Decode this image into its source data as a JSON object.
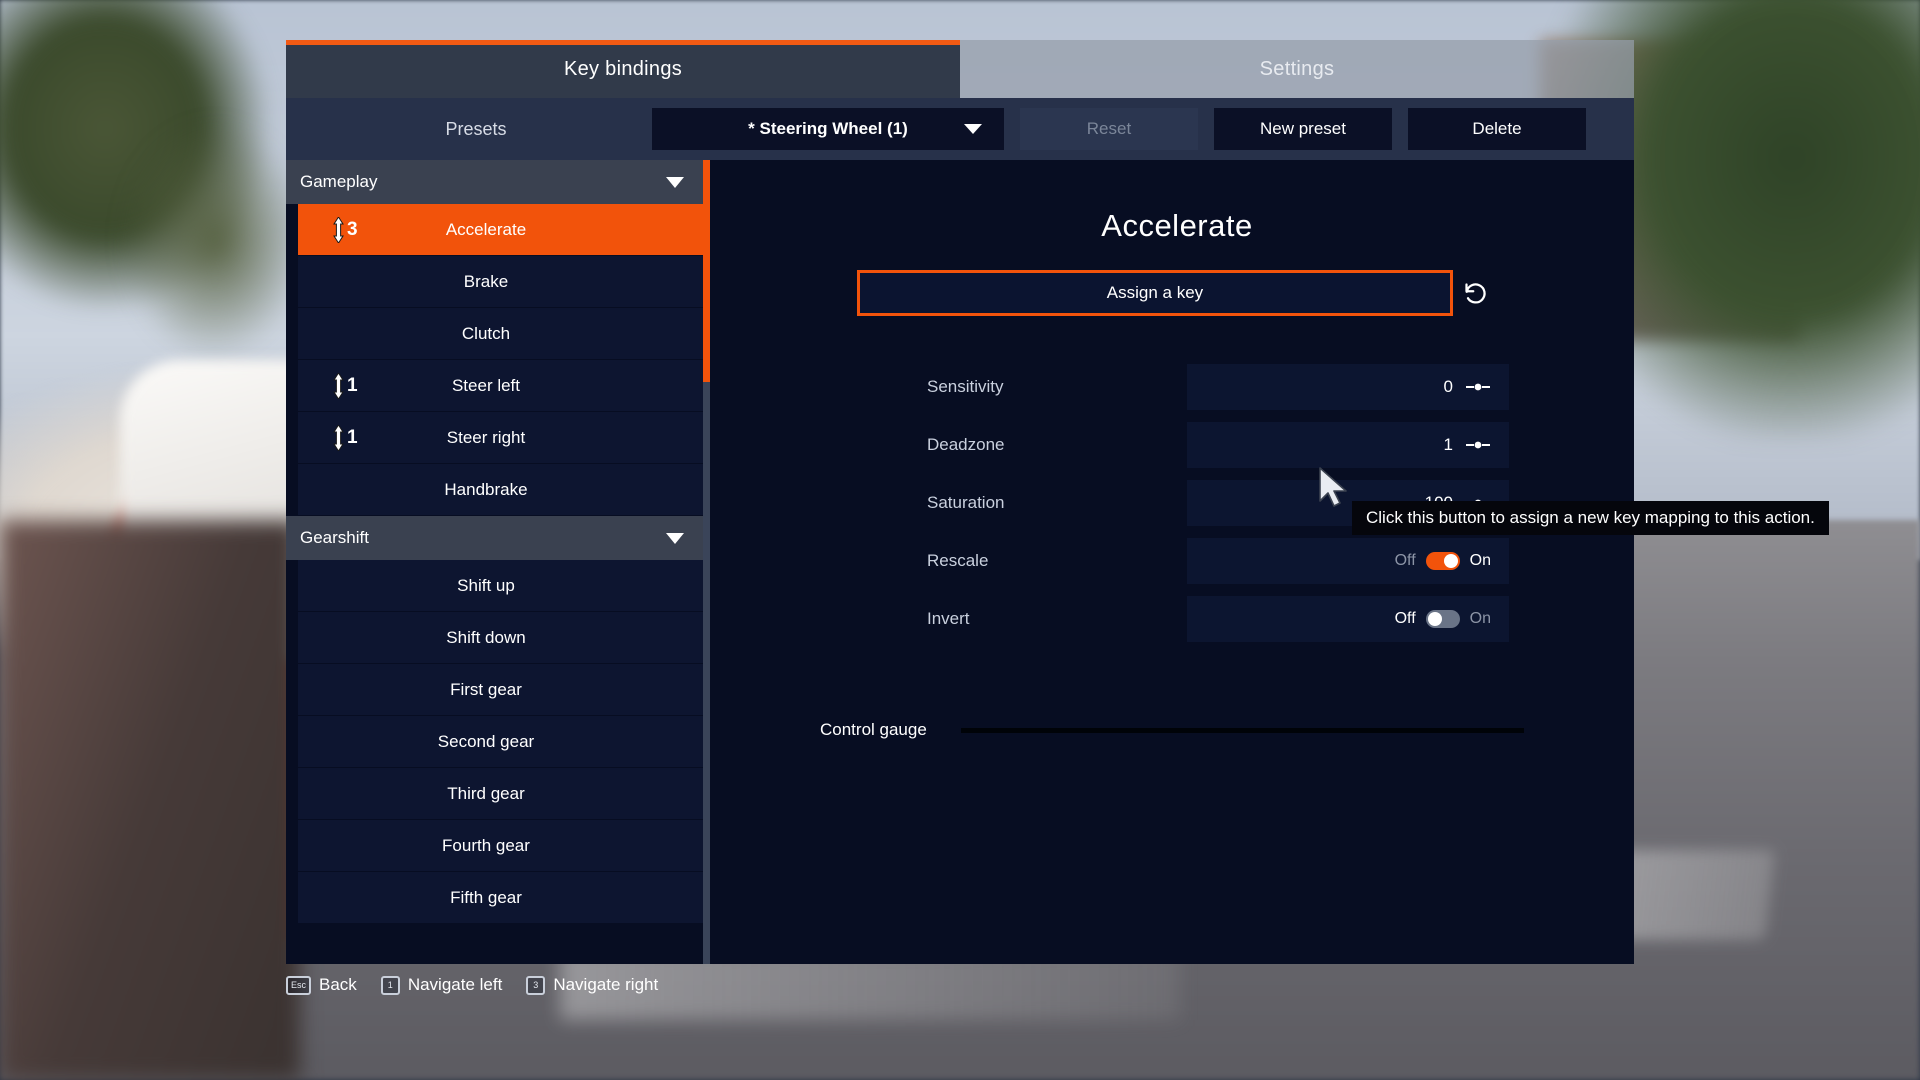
{
  "tabs": [
    {
      "label": "Key bindings",
      "active": true
    },
    {
      "label": "Settings",
      "active": false
    }
  ],
  "presets": {
    "label": "Presets",
    "selected": "* Steering Wheel (1)",
    "buttons": [
      {
        "label": "Reset",
        "disabled": true
      },
      {
        "label": "New preset",
        "disabled": false
      },
      {
        "label": "Delete",
        "disabled": false
      }
    ]
  },
  "sidebar": {
    "sections": [
      {
        "title": "Gameplay",
        "collapsed": false,
        "items": [
          {
            "label": "Accelerate",
            "axis": "3",
            "selected": true
          },
          {
            "label": "Brake",
            "axis": "",
            "selected": false
          },
          {
            "label": "Clutch",
            "axis": "",
            "selected": false
          },
          {
            "label": "Steer left",
            "axis": "1",
            "selected": false
          },
          {
            "label": "Steer right",
            "axis": "1",
            "selected": false
          },
          {
            "label": "Handbrake",
            "axis": "",
            "selected": false
          }
        ]
      },
      {
        "title": "Gearshift",
        "collapsed": false,
        "items": [
          {
            "label": "Shift up",
            "axis": "",
            "selected": false
          },
          {
            "label": "Shift down",
            "axis": "",
            "selected": false
          },
          {
            "label": "First gear",
            "axis": "",
            "selected": false
          },
          {
            "label": "Second gear",
            "axis": "",
            "selected": false
          },
          {
            "label": "Third gear",
            "axis": "",
            "selected": false
          },
          {
            "label": "Fourth gear",
            "axis": "",
            "selected": false
          },
          {
            "label": "Fifth gear",
            "axis": "",
            "selected": false
          }
        ]
      }
    ]
  },
  "main": {
    "title": "Accelerate",
    "assign_label": "Assign a key",
    "reset_icon": "undo-icon",
    "tooltip": "Click this button to assign a new key mapping to this action.",
    "settings": [
      {
        "name": "Sensitivity",
        "type": "stepper",
        "value": "0"
      },
      {
        "name": "Deadzone",
        "type": "stepper",
        "value": "1"
      },
      {
        "name": "Saturation",
        "type": "stepper",
        "value": "100"
      },
      {
        "name": "Rescale",
        "type": "toggle",
        "off": "Off",
        "on": "On",
        "state": "on"
      },
      {
        "name": "Invert",
        "type": "toggle",
        "off": "Off",
        "on": "On",
        "state": "off"
      }
    ],
    "gauge_label": "Control gauge",
    "gauge_value": 0
  },
  "footer": [
    {
      "key": "Esc",
      "label": "Back"
    },
    {
      "key": "1",
      "label": "Navigate left"
    },
    {
      "key": "3",
      "label": "Navigate right"
    }
  ],
  "colors": {
    "accent": "#f2530b",
    "panel_dark": "#070d22",
    "row": "#0d1530",
    "preset_bar": "#27314a",
    "tab_active": "#313a4a"
  }
}
